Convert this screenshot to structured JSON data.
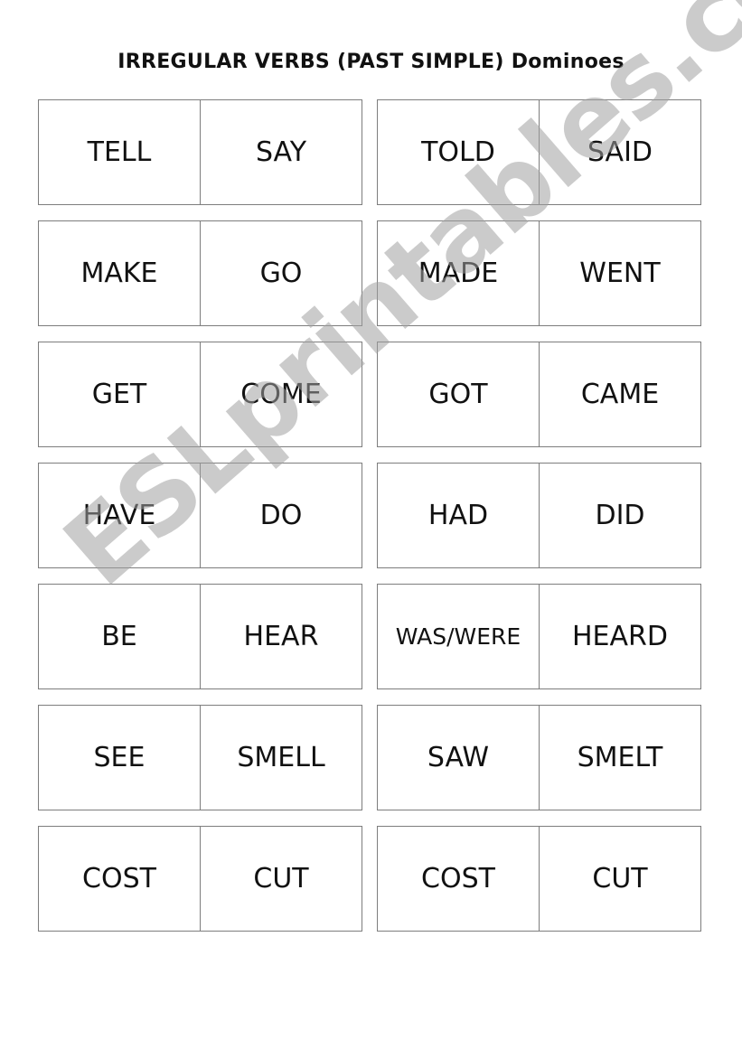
{
  "title": "IRREGULAR VERBS (PAST SIMPLE)  Dominoes",
  "watermark": "ESLprintables.com",
  "rows": [
    {
      "left": [
        "TELL",
        "SAY"
      ],
      "right": [
        "TOLD",
        "SAID"
      ]
    },
    {
      "left": [
        "MAKE",
        "GO"
      ],
      "right": [
        "MADE",
        "WENT"
      ]
    },
    {
      "left": [
        "GET",
        "COME"
      ],
      "right": [
        "GOT",
        "CAME"
      ]
    },
    {
      "left": [
        "HAVE",
        "DO"
      ],
      "right": [
        "HAD",
        "DID"
      ]
    },
    {
      "left": [
        "BE",
        "HEAR"
      ],
      "right": [
        "WAS/WERE",
        "HEARD"
      ]
    },
    {
      "left": [
        "SEE",
        "SMELL"
      ],
      "right": [
        "SAW",
        "SMELT"
      ]
    },
    {
      "left": [
        "COST",
        "CUT"
      ],
      "right": [
        "COST",
        "CUT"
      ]
    }
  ]
}
